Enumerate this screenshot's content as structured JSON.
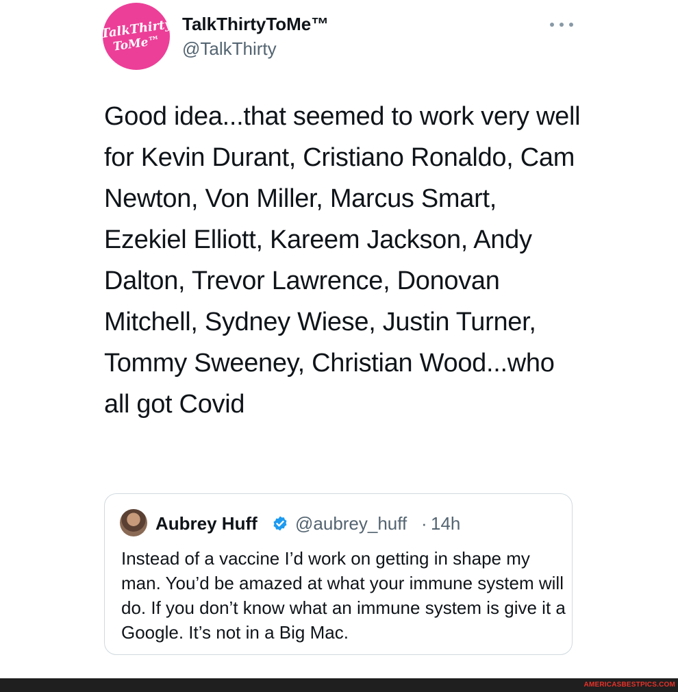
{
  "tweet": {
    "avatar_logo": {
      "line1": "TalkThirty",
      "line2": "ToMe™",
      "color": "#ec3f98"
    },
    "author_name": "TalkThirtyToMe™",
    "author_handle": "@TalkThirty",
    "more_icon": "more-horizontal-icon",
    "text": "Good idea...that seemed to work very well for Kevin Durant, Cristiano Ronaldo, Cam Newton, Von Miller, Marcus Smart, Ezekiel Elliott, Kareem Jackson, Andy Dalton, Trevor Lawrence, Donovan Mitchell, Sydney Wiese, Justin Turner, Tommy Sweeney, Christian Wood...who all got Covid"
  },
  "quoted_tweet": {
    "author_name": "Aubrey Huff",
    "verified_icon": "verified-badge-icon",
    "verified_color": "#1d9bf0",
    "author_handle": "@aubrey_huff",
    "separator": "·",
    "time": "14h",
    "text": "Instead of a vaccine I’d work on getting in shape my man. You’d be amazed at what your immune system will do. If you don’t know what an immune system is give it a Google. It’s not in a Big Mac."
  },
  "footer": {
    "watermark": "AMERICASBESTPICS.COM",
    "watermark_color": "#e8322a"
  }
}
